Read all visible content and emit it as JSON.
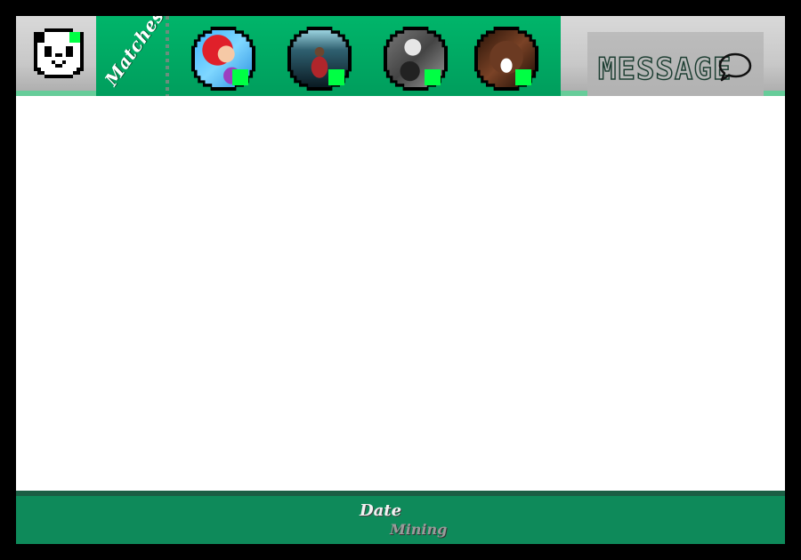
{
  "app": {
    "brand_line1": "Date",
    "brand_line2": "Mining"
  },
  "profile": {
    "icon": "panda-icon",
    "online": true
  },
  "matches": {
    "label": "Matches",
    "items": [
      {
        "icon": "avatar-redhead-mermaid",
        "online": true
      },
      {
        "icon": "avatar-person-spotlight",
        "online": true
      },
      {
        "icon": "avatar-gray-cat",
        "online": true
      },
      {
        "icon": "avatar-grinning-face",
        "online": true
      }
    ]
  },
  "message_button": {
    "label": "MESSAGE",
    "icon": "speech-bubble-icon"
  },
  "colors": {
    "accent_green": "#009c5c",
    "footer_green": "#0e8a5a",
    "online_green": "#00ff44",
    "stripe_mint": "#66cc99"
  }
}
